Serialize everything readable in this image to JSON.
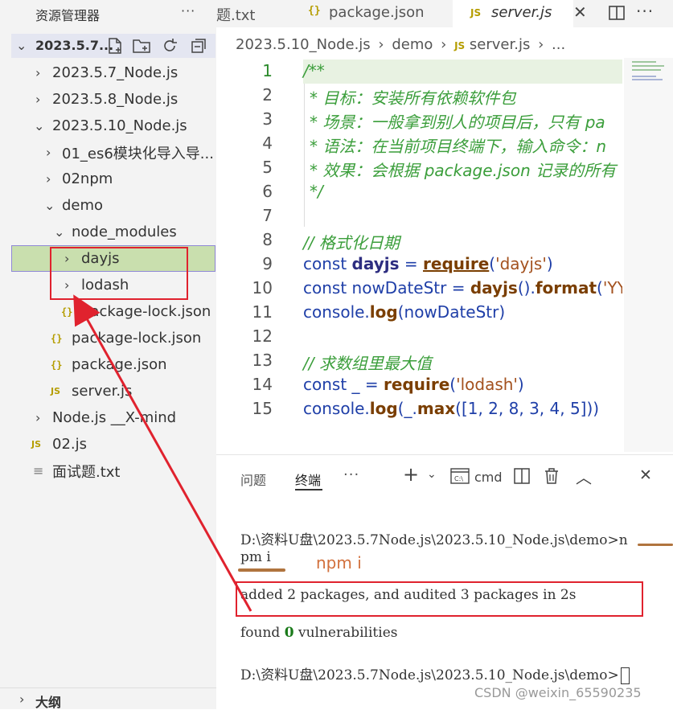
{
  "sidebar": {
    "title": "资源管理器",
    "more": "···",
    "root_label": "2023.5.7...",
    "outline_label": "大纲",
    "tree": [
      {
        "label": "2023.5.7_Node.js",
        "chev": ">"
      },
      {
        "label": "2023.5.8_Node.js",
        "chev": ">"
      },
      {
        "label": "2023.5.10_Node.js",
        "chev": "v"
      },
      {
        "label": "01_es6模块化导入导...",
        "chev": ">"
      },
      {
        "label": "02npm",
        "chev": ">"
      },
      {
        "label": "demo",
        "chev": "v"
      },
      {
        "label": "node_modules",
        "chev": "v"
      },
      {
        "label": "dayjs",
        "chev": ">"
      },
      {
        "label": "lodash",
        "chev": ">"
      },
      {
        "label": "package-lock.json",
        "icon": "{}"
      },
      {
        "label": "package-lock.json",
        "icon": "{}"
      },
      {
        "label": "package.json",
        "icon": "{}"
      },
      {
        "label": "server.js",
        "icon": "JS"
      },
      {
        "label": "Node.js __X-mind",
        "chev": ">"
      },
      {
        "label": "02.js",
        "icon": "JS"
      },
      {
        "label": "面试题.txt",
        "icon": "≡"
      }
    ]
  },
  "tabs": {
    "tab1": "题.txt",
    "tab2": "package.json",
    "tab3": "server.js",
    "json_icon": "{}",
    "js_icon": "JS"
  },
  "breadcrumb": {
    "p1": "2023.5.10_Node.js",
    "p2": "demo",
    "p3": "server.js",
    "p4": "..."
  },
  "code": {
    "l1": "/**",
    "l2": "* 目标：安装所有依赖软件包",
    "l3": "* 场景：一般拿到别人的项目后，只有 pa",
    "l4": "* 语法：在当前项目终端下，输入命令：n",
    "l5": "* 效果：会根据 package.json 记录的所有",
    "l6": "*/",
    "l8": "// 格式化日期",
    "l9": {
      "a": "const ",
      "b": "dayjs",
      "c": " = ",
      "d": "require",
      "e": "(",
      "f": "'dayjs'",
      "g": ")"
    },
    "l10": {
      "a": "const nowDateStr = ",
      "b": "dayjs",
      "c": "().",
      "d": "format",
      "e": "(",
      "f": "'YY"
    },
    "l11": {
      "a": "console.",
      "b": "log",
      "c": "(nowDateStr)"
    },
    "l13": "// 求数组里最大值",
    "l14": {
      "a": "const _ = ",
      "b": "require",
      "c": "(",
      "d": "'lodash'",
      "e": ")"
    },
    "l15": {
      "a": "console.",
      "b": "log",
      "c": "(_.",
      "d": "max",
      "e": "([1, 2, 8, 3, 4, 5]))"
    }
  },
  "panel": {
    "tab_problems": "问题",
    "tab_terminal": "终端",
    "more": "···",
    "cmd_label": "cmd",
    "term1": "D:\\资料U盘\\2023.5.7Node.js\\2023.5.10_Node.js\\demo>n",
    "term2": "pm i",
    "term3": "added 2 packages, and audited 3 packages in 2s",
    "term4a": "found ",
    "term4b": "0",
    "term4c": " vulnerabilities",
    "term5": "D:\\资料U盘\\2023.5.7Node.js\\2023.5.10_Node.js\\demo>"
  },
  "annotation": {
    "npm_note": "npm i"
  },
  "watermark": "CSDN @weixin_65590235",
  "colors": {
    "annotation_red": "#e0222e",
    "annotation_brown": "#b0743e"
  }
}
